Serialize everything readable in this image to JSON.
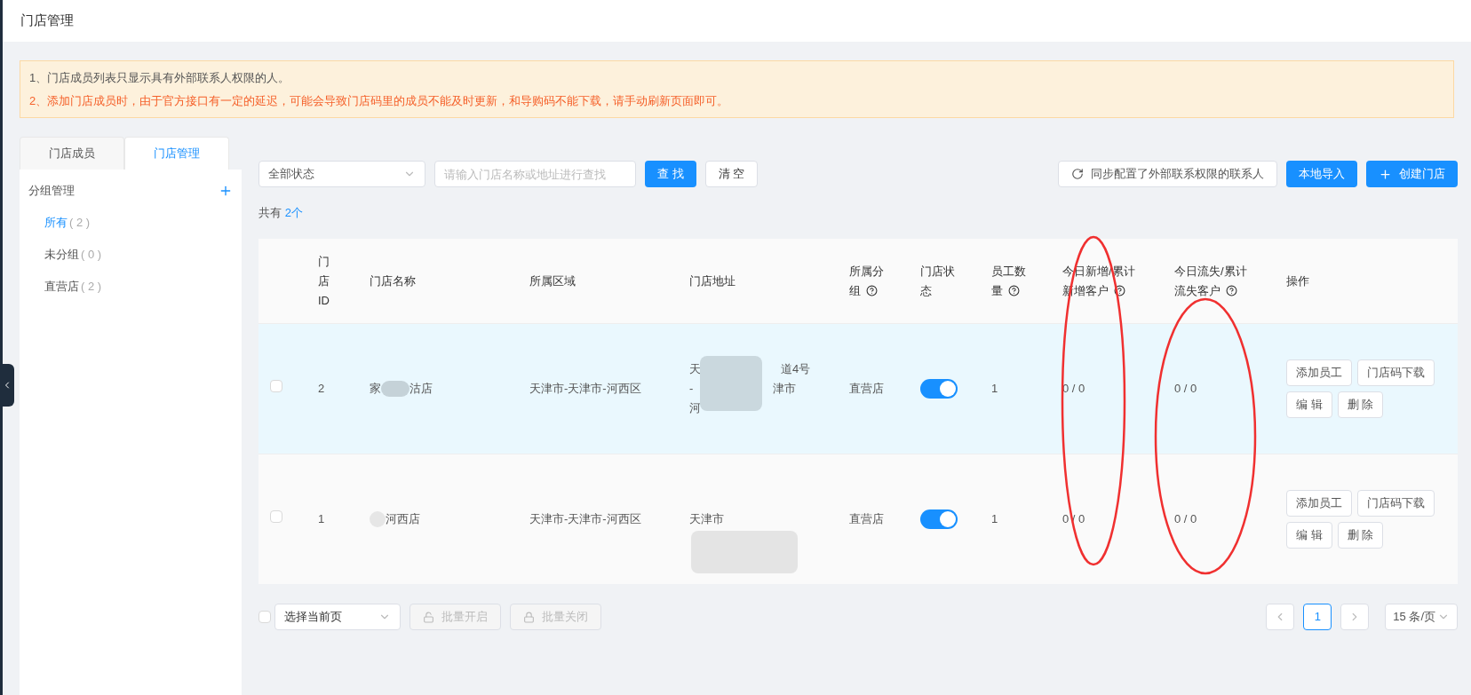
{
  "header": {
    "title": "门店管理"
  },
  "notice": {
    "lines": [
      {
        "kind": "info",
        "text": "1、门店成员列表只显示具有外部联系人权限的人。"
      },
      {
        "kind": "warning",
        "text": "2、添加门店成员时，由于官方接口有一定的延迟，可能会导致门店码里的成员不能及时更新，和导购码不能下载，请手动刷新页面即可。"
      }
    ]
  },
  "sidebar": {
    "tabs": [
      {
        "label": "门店成员",
        "selected": false
      },
      {
        "label": "门店管理",
        "selected": true
      }
    ],
    "group_title": "分组管理",
    "groups": [
      {
        "label": "所有",
        "count": "( 2 )",
        "selected": true
      },
      {
        "label": "未分组",
        "count": "( 0 )",
        "selected": false
      },
      {
        "label": "直营店",
        "count": "( 2 )",
        "selected": false
      }
    ]
  },
  "toolbar": {
    "status_select": "全部状态",
    "search": {
      "placeholder": "请输入门店名称或地址进行查找"
    },
    "search_button": "查 找",
    "clear_button": "清 空",
    "sync_button": "同步配置了外部联系权限的联系人",
    "import_button": "本地导入",
    "create_button": "创建门店"
  },
  "summary": {
    "label": "共有",
    "count": "2个"
  },
  "table": {
    "columns": [
      {
        "label": "门店ID",
        "help": false
      },
      {
        "label": "门店名称",
        "help": false
      },
      {
        "label": "所属区域",
        "help": false
      },
      {
        "label": "门店地址",
        "help": false
      },
      {
        "label": "所属分组",
        "help": true
      },
      {
        "label": "门店状态",
        "help": false
      },
      {
        "label": "员工数量",
        "help": true
      },
      {
        "label": "今日新增/累计新增客户",
        "help": true
      },
      {
        "label": "今日流失/累计流失客户",
        "help": true
      },
      {
        "label": "操作",
        "help": false
      }
    ],
    "rows": [
      {
        "checked": false,
        "highlighted": true,
        "id": "2",
        "name_parts": [
          "家",
          "沽店"
        ],
        "region": "天津市-天津市-河西区",
        "address_lines": [
          [
            "天",
            "道4号"
          ],
          [
            "-",
            "津市"
          ],
          [
            "河"
          ]
        ],
        "group": "直营店",
        "enabled": true,
        "staff": "1",
        "new_customers": "0 / 0",
        "lost_customers": "0 / 0",
        "actions": [
          "添加员工",
          "门店码下载",
          "编 辑",
          "删 除"
        ]
      },
      {
        "checked": false,
        "highlighted": false,
        "id": "1",
        "name_parts": [
          "河西店"
        ],
        "region": "天津市-天津市-河西区",
        "address_lines": [
          [
            "天津市"
          ]
        ],
        "group": "直营店",
        "enabled": true,
        "staff": "1",
        "new_customers": "0 / 0",
        "lost_customers": "0 / 0",
        "actions": [
          "添加员工",
          "门店码下载",
          "编 辑",
          "删 除"
        ]
      }
    ]
  },
  "annotations": [
    {
      "kind": "ellipse"
    },
    {
      "kind": "ellipse"
    }
  ],
  "footer": {
    "select_all_checked": false,
    "page_select": "选择当前页",
    "bulk_buttons": [
      {
        "label": "批量开启",
        "disabled": true
      },
      {
        "label": "批量关闭",
        "disabled": true
      }
    ],
    "pages": [
      {
        "label": "1",
        "selected": true
      }
    ],
    "page_size": "15 条/页"
  }
}
